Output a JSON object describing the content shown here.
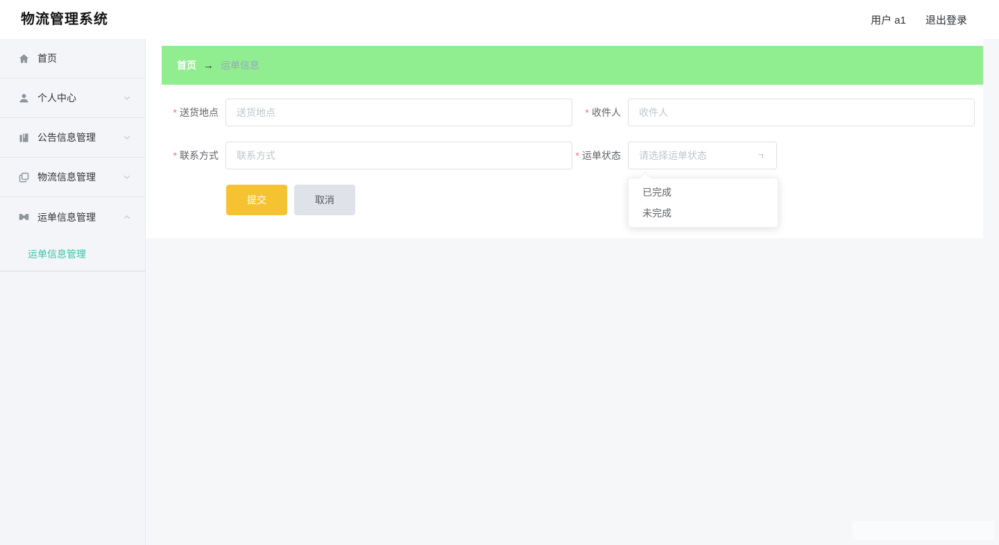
{
  "header": {
    "title": "物流管理系统",
    "user": "用户 a1",
    "logout": "退出登录"
  },
  "sidebar": {
    "items": [
      {
        "label": "首页",
        "icon": "home-icon"
      },
      {
        "label": "个人中心",
        "icon": "user-icon",
        "chevron": "down"
      },
      {
        "label": "公告信息管理",
        "icon": "notice-icon",
        "chevron": "down"
      },
      {
        "label": "物流信息管理",
        "icon": "logistics-icon",
        "chevron": "down"
      },
      {
        "label": "运单信息管理",
        "icon": "waybill-icon",
        "chevron": "up"
      }
    ],
    "subitems": [
      {
        "label": "运单信息管理",
        "active": true
      }
    ]
  },
  "breadcrumb": {
    "home": "首页",
    "separator": "→",
    "current": "运单信息"
  },
  "form": {
    "required_marker": "*",
    "fields": {
      "delivery_location": {
        "label": "送货地点",
        "placeholder": "送货地点",
        "value": ""
      },
      "recipient": {
        "label": "收件人",
        "placeholder": "收件人",
        "value": ""
      },
      "contact": {
        "label": "联系方式",
        "placeholder": "联系方式",
        "value": ""
      },
      "status": {
        "label": "运单状态",
        "placeholder": "请选择运单状态",
        "value": ""
      }
    },
    "buttons": {
      "submit": "提交",
      "cancel": "取消"
    },
    "status_dropdown": {
      "options": [
        "已完成",
        "未完成"
      ]
    }
  },
  "colors": {
    "breadcrumb_bg": "#90ee90",
    "submit_bg": "#f5c332",
    "cancel_bg": "#dfe2e8",
    "active_menu": "#3ec3a8",
    "required": "#f56c6c",
    "placeholder": "#c0c4cc"
  }
}
